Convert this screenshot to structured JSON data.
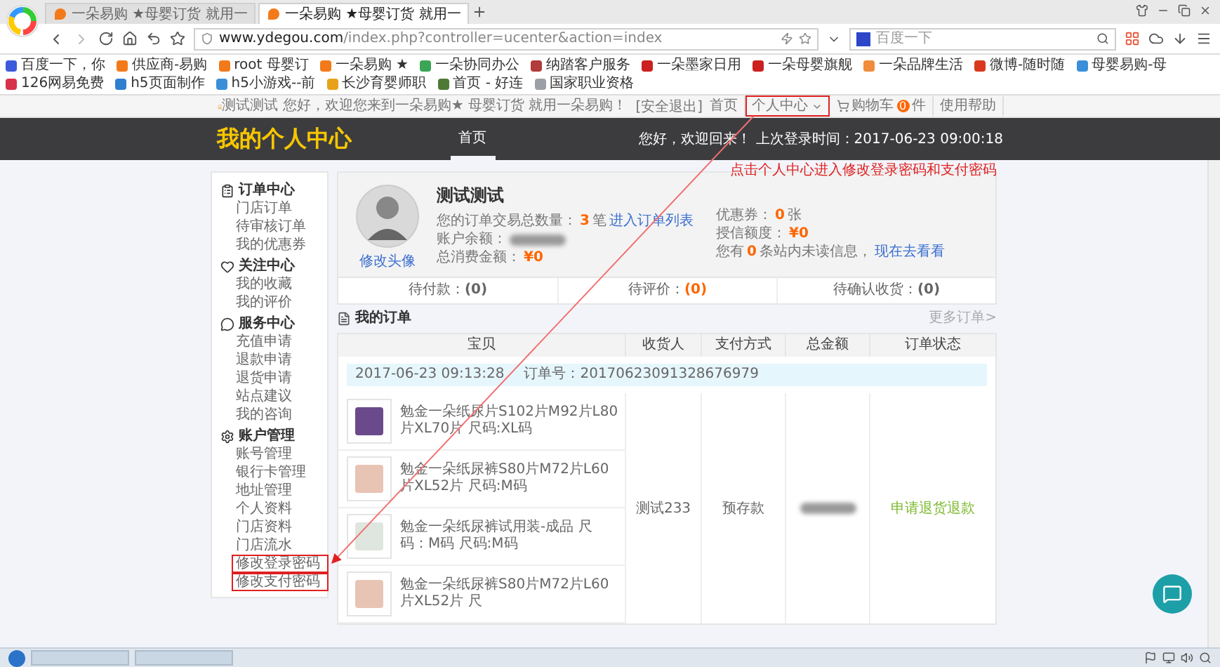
{
  "browser": {
    "tabs": [
      {
        "title": "一朵易购 ★母婴订货 就用一",
        "selected": false
      },
      {
        "title": "一朵易购 ★母婴订货 就用一",
        "selected": true
      }
    ],
    "url": {
      "domain": "www.ydegou.com",
      "path": "/index.php?controller=ucenter&action=index"
    },
    "search": {
      "placeholder": "百度一下"
    },
    "bookmarks": [
      {
        "label": "百度一下，你",
        "color": "#3b5bdb"
      },
      {
        "label": "供应商-易购",
        "color": "#f27a1a"
      },
      {
        "label": "root 母婴订",
        "color": "#f27a1a"
      },
      {
        "label": "一朵易购 ★",
        "color": "#f27a1a"
      },
      {
        "label": "一朵协同办公",
        "color": "#3aa655"
      },
      {
        "label": "纳踏客户服务",
        "color": "#b23b3b"
      },
      {
        "label": "一朵墨家日用",
        "color": "#cc1f1f"
      },
      {
        "label": "一朵母婴旗舰",
        "color": "#cc1f1f"
      },
      {
        "label": "一朵品牌生活",
        "color": "#f08c3a"
      },
      {
        "label": "微博-随时随",
        "color": "#d9381e"
      },
      {
        "label": "母婴易购-母",
        "color": "#3b8fd9"
      },
      {
        "label": "126网易免费",
        "color": "#d6334b"
      },
      {
        "label": "h5页面制作",
        "color": "#2f7fcf"
      },
      {
        "label": "h5小游戏--前",
        "color": "#3b8fd9"
      },
      {
        "label": "长沙育婴师职",
        "color": "#e8a21a"
      },
      {
        "label": "首页 - 好连",
        "color": "#4f7a35"
      },
      {
        "label": "国家职业资格",
        "color": "#9aa0a6"
      }
    ]
  },
  "topbar": {
    "greeting": "测试测试 您好，欢迎您来到一朵易购★ 母婴订货 就用一朵易购！",
    "logout": "[安全退出]",
    "links": [
      {
        "kind": "link",
        "label": "首页",
        "highlighted": false
      },
      {
        "kind": "dropdown",
        "label": "个人中心",
        "highlighted": true
      },
      {
        "kind": "cart",
        "label": "购物车",
        "count": "0",
        "unit": "件",
        "highlighted": false
      },
      {
        "kind": "link",
        "label": "使用帮助",
        "highlighted": false
      }
    ]
  },
  "header": {
    "title": "我的个人中心",
    "nav": [
      {
        "label": "首页",
        "selected": true
      }
    ],
    "welcome": "您好，欢迎回来！ 上次登录时间：2017-06-23 09:00:18"
  },
  "annotation": "点击个人中心进入修改登录密码和支付密码",
  "sidebar": [
    {
      "kind": "orders",
      "heading": "订单中心",
      "items": [
        {
          "label": "门店订单",
          "highlighted": false
        },
        {
          "label": "待审核订单",
          "highlighted": false
        },
        {
          "label": "我的优惠券",
          "highlighted": false
        }
      ]
    },
    {
      "kind": "follow",
      "heading": "关注中心",
      "items": [
        {
          "label": "我的收藏",
          "highlighted": false
        },
        {
          "label": "我的评价",
          "highlighted": false
        }
      ]
    },
    {
      "kind": "service",
      "heading": "服务中心",
      "items": [
        {
          "label": "充值申请",
          "highlighted": false
        },
        {
          "label": "退款申请",
          "highlighted": false
        },
        {
          "label": "退货申请",
          "highlighted": false
        },
        {
          "label": "站点建议",
          "highlighted": false
        },
        {
          "label": "我的咨询",
          "highlighted": false
        }
      ]
    },
    {
      "kind": "account",
      "heading": "账户管理",
      "items": [
        {
          "label": "账号管理",
          "highlighted": false
        },
        {
          "label": "银行卡管理",
          "highlighted": false
        },
        {
          "label": "地址管理",
          "highlighted": false
        },
        {
          "label": "个人资料",
          "highlighted": false
        },
        {
          "label": "门店资料",
          "highlighted": false
        },
        {
          "label": "门店流水",
          "highlighted": false
        },
        {
          "label": "修改登录密码",
          "highlighted": true
        },
        {
          "label": "修改支付密码",
          "highlighted": true
        }
      ]
    }
  ],
  "profile": {
    "name": "测试测试",
    "avatar_link": "修改头像",
    "left": [
      {
        "label": "您的订单交易总数量：",
        "value": "3",
        "unit": "笔",
        "link": "进入订单列表"
      },
      {
        "label": "账户余额：",
        "redacted": true
      },
      {
        "label": "总消费金额：",
        "value": "¥0"
      }
    ],
    "right": [
      {
        "label": "优惠券：",
        "value": "0",
        "unit": "张"
      },
      {
        "label": "授信额度：",
        "value": "¥0"
      },
      {
        "label": "您有",
        "value": "0",
        "unit": "条站内未读信息，",
        "link": "现在去看看"
      }
    ]
  },
  "order_counts": [
    {
      "label": "待付款：",
      "value": "(0)",
      "highlighted": false
    },
    {
      "label": "待评价：",
      "value": "(0)",
      "highlighted": true
    },
    {
      "label": "待确认收货：",
      "value": "(0)",
      "highlighted": false
    }
  ],
  "orders": {
    "title": "我的订单",
    "more": "更多订单>",
    "columns": [
      "宝贝",
      "收货人",
      "支付方式",
      "总金额",
      "订单状态"
    ],
    "order": {
      "date": "2017-06-23 09:13:28",
      "number": "订单号：20170623091328676979",
      "items": [
        {
          "name": "勉金一朵纸尿片S102片M92片L80片XL70片 尺码:XL码",
          "color": "#6b4a8c"
        },
        {
          "name": "勉金一朵纸尿裤S80片M72片L60片XL52片 尺码:M码",
          "color": "#e8c4b4"
        },
        {
          "name": "勉金一朵纸尿裤试用装-成品 尺码：M码 尺码:M码",
          "color": "#dfe6df"
        },
        {
          "name": "勉金一朵纸尿裤S80片M72片L60片XL52片 尺",
          "color": "#e8c4b4"
        }
      ],
      "receiver": "测试233",
      "payment": "预存款",
      "total_redacted": true,
      "status": "申请退货退款"
    }
  }
}
